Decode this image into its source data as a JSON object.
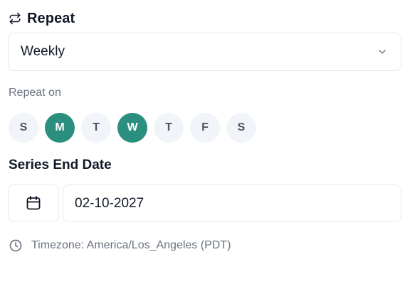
{
  "repeat": {
    "title": "Repeat",
    "icon": "repeat-icon",
    "selected": "Weekly",
    "dropdown_icon": "chevron-down-icon"
  },
  "repeat_on": {
    "label": "Repeat on",
    "days": [
      {
        "label": "S",
        "active": false
      },
      {
        "label": "M",
        "active": true
      },
      {
        "label": "T",
        "active": false
      },
      {
        "label": "W",
        "active": true
      },
      {
        "label": "T",
        "active": false
      },
      {
        "label": "F",
        "active": false
      },
      {
        "label": "S",
        "active": false
      }
    ]
  },
  "series_end": {
    "label": "Series End Date",
    "calendar_icon": "calendar-icon",
    "date_value": "02-10-2027"
  },
  "timezone": {
    "icon": "clock-icon",
    "text": "Timezone: America/Los_Angeles (PDT)"
  },
  "colors": {
    "accent": "#2a8f7e",
    "day_inactive_bg": "#f1f4f9",
    "muted_text": "#6b7280",
    "border": "#e5e7eb"
  }
}
